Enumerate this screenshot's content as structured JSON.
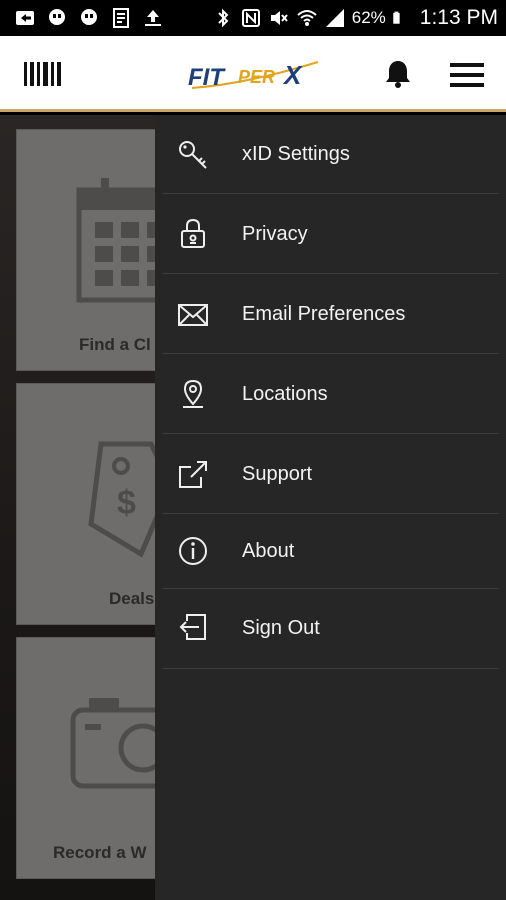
{
  "status_bar": {
    "battery": "62%",
    "time": "1:13 PM"
  },
  "header": {
    "logo_text": "FITPERX",
    "logo_fit": "FIT",
    "logo_per": "PER",
    "logo_x": "X"
  },
  "tiles": [
    {
      "label": "Find a Cl",
      "icon": "calendar-icon"
    },
    {
      "label": "Deals",
      "icon": "price-tag-icon"
    },
    {
      "label": "Record a W",
      "icon": "camera-icon"
    }
  ],
  "menu": {
    "items": [
      {
        "label": "xID Settings",
        "icon": "key-icon"
      },
      {
        "label": "Privacy",
        "icon": "lock-icon"
      },
      {
        "label": "Email Preferences",
        "icon": "envelope-icon"
      },
      {
        "label": "Locations",
        "icon": "location-pin-icon"
      },
      {
        "label": "Support",
        "icon": "external-link-icon"
      },
      {
        "label": "About",
        "icon": "info-icon"
      },
      {
        "label": "Sign Out",
        "icon": "sign-out-icon"
      }
    ]
  },
  "colors": {
    "drawer_bg": "#262626",
    "header_bg": "#ffffff",
    "logo_blue": "#1d3f7a",
    "logo_gold": "#e2a41c",
    "accent_border": "#c9a86a"
  }
}
